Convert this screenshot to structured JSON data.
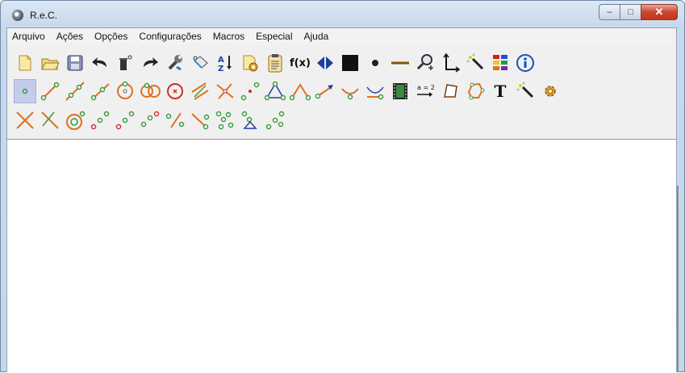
{
  "window": {
    "title": "R.e.C.",
    "minimize_glyph": "–",
    "maximize_glyph": "□",
    "close_glyph": "✕"
  },
  "menubar": {
    "items": [
      "Arquivo",
      "Ações",
      "Opções",
      "Configurações",
      "Macros",
      "Especial",
      "Ajuda"
    ]
  },
  "toolbar": {
    "function_label": "f(x)",
    "text_tool_label": "T",
    "equation_label_top": "a = 2",
    "row1": [
      "new-file-icon",
      "open-folder-icon",
      "save-icon",
      "undo-icon",
      "delete-object-icon",
      "redo-icon",
      "wrench-icon",
      "eraser-icon",
      "sort-az-icon",
      "document-settings-icon",
      "clipboard-icon",
      "function-icon",
      "split-arrows-icon",
      "black-square-icon",
      "dot-icon",
      "line-segment-icon",
      "zoom-icon",
      "axes-icon",
      "magic-wand-icon",
      "color-palette-icon",
      "info-icon"
    ],
    "row2": [
      "point-tool-icon",
      "segment-tool-icon",
      "line-tool-icon",
      "ray-tool-icon",
      "circle-center-icon",
      "two-circles-icon",
      "circle-point-icon",
      "parallel-icon",
      "intersection-icon",
      "midpoint-icon",
      "triangle-icon",
      "angle-icon",
      "vector-icon",
      "arc-icon",
      "curve-icon",
      "film-icon",
      "equation-icon",
      "polygon-icon",
      "polygon-points-icon",
      "text-icon",
      "magic-wand-icon",
      "gear-icon"
    ],
    "row3": [
      "cross-lines-icon",
      "perpendicular-icon",
      "circle-radius-icon",
      "reflect-point-icon",
      "rotate-point-icon",
      "dilate-icon",
      "translate-icon",
      "locus-icon",
      "trace-icon",
      "rotate-triangle-icon",
      "transform-icon"
    ]
  },
  "colors": {
    "accent": "#4a5fb0",
    "selected_tool_bg": "#c4ccec",
    "close_button": "#c4371d",
    "orange": "#e07020",
    "green_point": "#3a9a3a",
    "red": "#cc2020"
  }
}
